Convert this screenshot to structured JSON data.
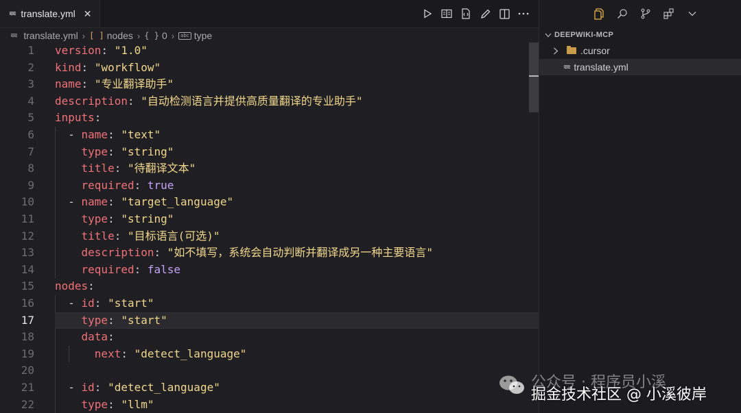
{
  "tab": {
    "file_icon": "yaml-file-icon",
    "label": "translate.yml",
    "close_glyph": "✕"
  },
  "breadcrumb": {
    "file": "translate.yml",
    "nodes_label": "nodes",
    "index_label": "0",
    "type_label": "type",
    "abc_badge": "abc"
  },
  "editor_actions": [
    "run-icon",
    "preview-icon",
    "open-changes-icon",
    "edit-icon",
    "split-editor-icon",
    "more-actions-icon"
  ],
  "code": {
    "active_line": 17,
    "lines": [
      {
        "n": "1",
        "text": "version: \"1.0\""
      },
      {
        "n": "2",
        "text": "kind: \"workflow\""
      },
      {
        "n": "3",
        "text": "name: \"专业翻译助手\""
      },
      {
        "n": "4",
        "text": "description: \"自动检测语言并提供高质量翻译的专业助手\""
      },
      {
        "n": "5",
        "text": "inputs:"
      },
      {
        "n": "6",
        "text": "  - name: \"text\""
      },
      {
        "n": "7",
        "text": "    type: \"string\""
      },
      {
        "n": "8",
        "text": "    title: \"待翻译文本\""
      },
      {
        "n": "9",
        "text": "    required: true"
      },
      {
        "n": "10",
        "text": "  - name: \"target_language\""
      },
      {
        "n": "11",
        "text": "    type: \"string\""
      },
      {
        "n": "12",
        "text": "    title: \"目标语言(可选)\""
      },
      {
        "n": "13",
        "text": "    description: \"如不填写，系统会自动判断并翻译成另一种主要语言\""
      },
      {
        "n": "14",
        "text": "    required: false"
      },
      {
        "n": "15",
        "text": "nodes:"
      },
      {
        "n": "16",
        "text": "  - id: \"start\""
      },
      {
        "n": "17",
        "text": "    type: \"start\""
      },
      {
        "n": "18",
        "text": "    data:"
      },
      {
        "n": "19",
        "text": "      next: \"detect_language\""
      },
      {
        "n": "20",
        "text": ""
      },
      {
        "n": "21",
        "text": "  - id: \"detect_language\""
      },
      {
        "n": "22",
        "text": "    type: \"llm\""
      }
    ]
  },
  "colors": {
    "key": "#f07178",
    "string": "#f1d78b",
    "boolean": "#c4a3f5",
    "folder": "#c89b4a"
  },
  "explorer": {
    "activity_icons": [
      "explorer-icon",
      "search-icon",
      "source-control-icon",
      "extensions-icon",
      "chevron-down-icon"
    ],
    "project": "DEEPWIKI-MCP",
    "items": [
      {
        "label": ".cursor",
        "kind": "folder"
      },
      {
        "label": "translate.yml",
        "kind": "file"
      }
    ]
  },
  "watermark": {
    "line1": "公众号 · 程序员小溪",
    "line2": "掘金技术社区 @ 小溪彼岸"
  }
}
